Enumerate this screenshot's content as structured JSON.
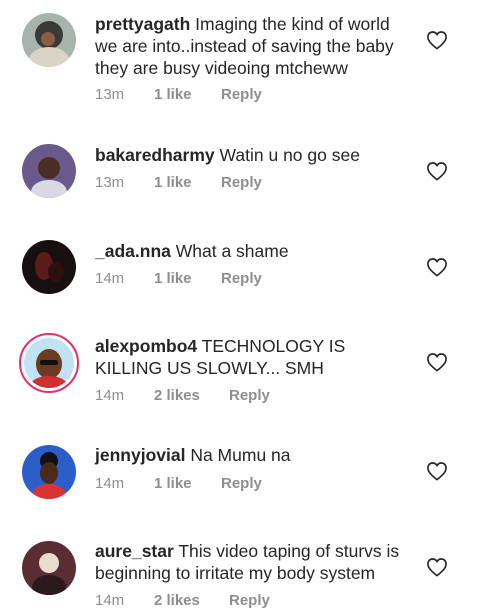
{
  "comments": [
    {
      "username": "prettyagath",
      "text": "Imaging the kind of world we are into..instead of saving the baby they are busy videoing mtcheww",
      "time": "13m",
      "likes": "1 like",
      "reply": "Reply"
    },
    {
      "username": "bakaredharmy",
      "text": "Watin u no go see",
      "time": "13m",
      "likes": "1 like",
      "reply": "Reply"
    },
    {
      "username": "_ada.nna",
      "text": "What a shame",
      "time": "14m",
      "likes": "1 like",
      "reply": "Reply"
    },
    {
      "username": "alexpombo4",
      "text": "TECHNOLOGY IS KILLING US SLOWLY... SMH",
      "time": "14m",
      "likes": "2 likes",
      "reply": "Reply"
    },
    {
      "username": "jennyjovial",
      "text": "Na Mumu na",
      "time": "14m",
      "likes": "1 like",
      "reply": "Reply"
    },
    {
      "username": "aure_star",
      "text": "This video taping of sturvs is beginning to irritate my body system",
      "time": "14m",
      "likes": "2 likes",
      "reply": "Reply"
    }
  ],
  "icons": {
    "like": "heart-outline-icon"
  },
  "colors": {
    "username": "#262626",
    "meta": "#8e8e8e",
    "story_ring": "#e1306c"
  }
}
